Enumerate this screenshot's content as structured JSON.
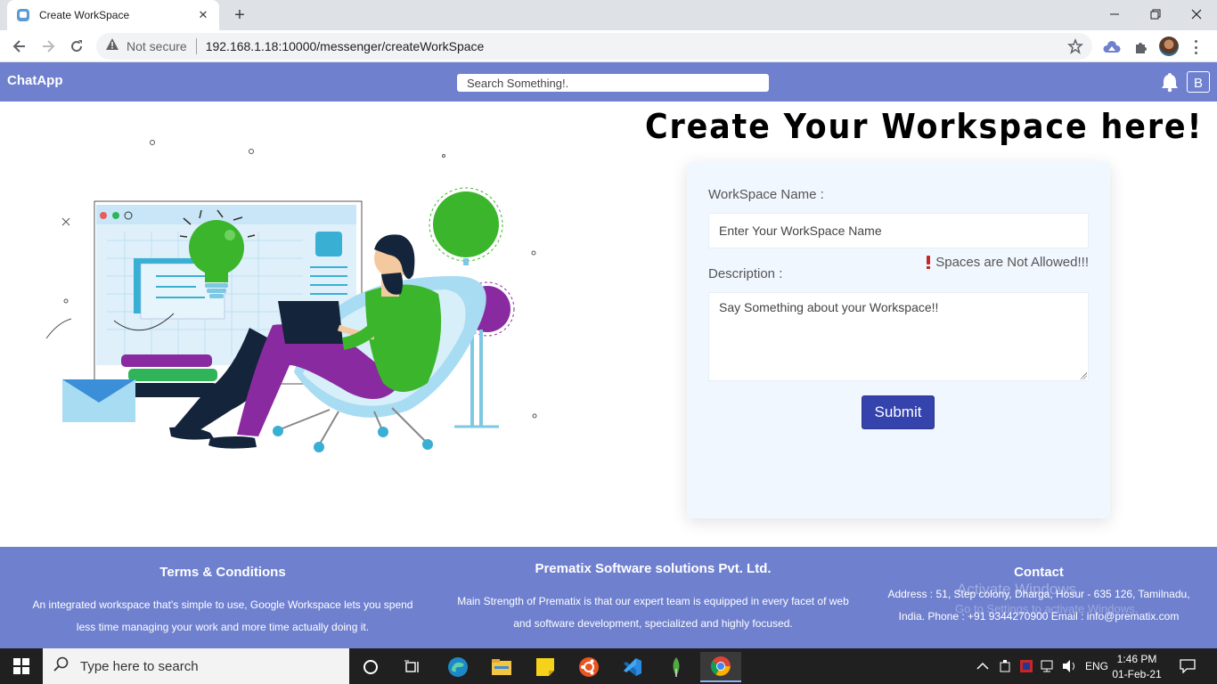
{
  "browser": {
    "tab_title": "Create WorkSpace",
    "security_label": "Not secure",
    "url": "192.168.1.18:10000/messenger/createWorkSpace"
  },
  "navbar": {
    "brand": "ChatApp",
    "search_placeholder": "Search Something!.",
    "user_initial": "B"
  },
  "main": {
    "title": "Create Your Workspace here!",
    "form": {
      "name_label": "WorkSpace Name :",
      "name_placeholder": "Enter Your WorkSpace Name",
      "warning": "Spaces are Not Allowed!!!",
      "description_label": "Description :",
      "description_placeholder": "Say Something about your Workspace!!",
      "submit_label": "Submit"
    }
  },
  "footer": {
    "terms": {
      "heading": "Terms & Conditions",
      "line1": "An integrated workspace that's simple to use, Google Workspace lets you spend",
      "line2": "less time managing your work and more time actually doing it."
    },
    "company": {
      "heading": "Prematix Software solutions Pvt. Ltd.",
      "line1": "Main Strength of Prematix is that our expert team is equipped in every facet of web",
      "line2": "and software development, specialized and highly focused."
    },
    "contact": {
      "heading": "Contact",
      "line1": "Address : 51, Step colony, Dharga, Hosur - 635 126, Tamilnadu,",
      "line2": "India. Phone : +91 9344270900 Email : info@prematix.com"
    },
    "watermark_title": "Activate Windows",
    "watermark_sub": "Go to Settings to activate Windows."
  },
  "taskbar": {
    "search_placeholder": "Type here to search",
    "language": "ENG",
    "time": "1:46 PM",
    "date": "01-Feb-21"
  },
  "colors": {
    "navbar": "#6f80cf",
    "submit": "#3543ad",
    "card": "#f1f7ff"
  }
}
